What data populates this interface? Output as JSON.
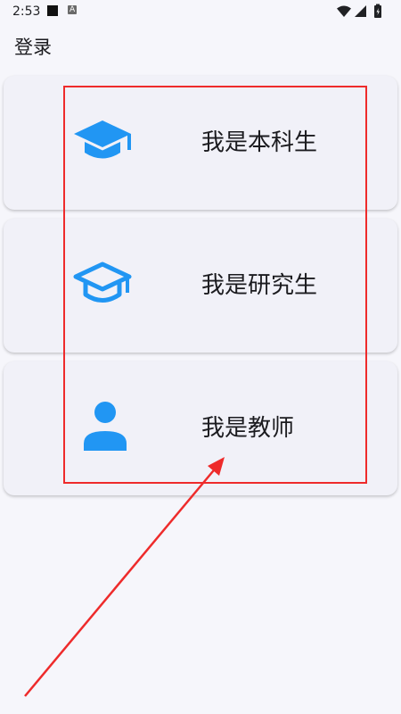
{
  "status_bar": {
    "time": "2:53",
    "notification_letter": "A"
  },
  "app_bar": {
    "title": "登录"
  },
  "roles": [
    {
      "label": "我是本科生",
      "icon": "mortarboard-filled-icon"
    },
    {
      "label": "我是研究生",
      "icon": "mortarboard-outline-icon"
    },
    {
      "label": "我是教师",
      "icon": "person-icon"
    }
  ],
  "colors": {
    "accent": "#2196f3",
    "background": "#f6f6fb",
    "card": "#f1f1f8",
    "annotation": "#ee2b2b"
  }
}
